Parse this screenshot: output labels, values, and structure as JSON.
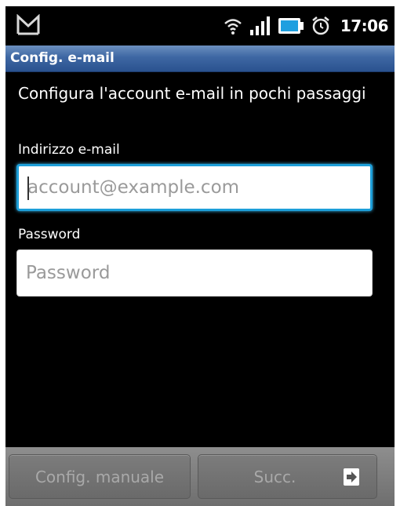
{
  "status_bar": {
    "time": "17:06",
    "icons": [
      "gmail-icon",
      "wifi-icon",
      "signal-icon",
      "battery-icon",
      "alarm-icon"
    ]
  },
  "title_bar": {
    "title": "Config. e-mail",
    "color": "#3e67a3"
  },
  "form": {
    "intro": "Configura l'account e-mail in pochi passaggi",
    "email_label": "Indirizzo e-mail",
    "email_placeholder": "account@example.com",
    "email_value": "",
    "password_label": "Password",
    "password_placeholder": "Password",
    "password_value": "",
    "focus_color": "#1d9fd9"
  },
  "buttons": {
    "manual_label": "Config. manuale",
    "next_label": "Succ.",
    "next_icon": "arrow-right-icon"
  }
}
